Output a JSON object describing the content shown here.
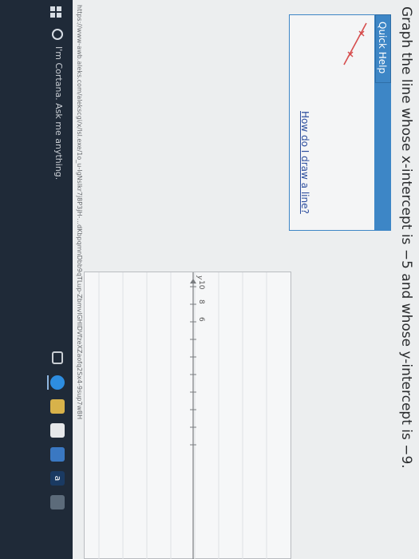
{
  "question": {
    "text": "Graph the line whose x-intercept is −5 and whose y-intercept is −9."
  },
  "quick_help": {
    "tab_label": "Quick Help",
    "link_text": "How do I draw a line?",
    "icon": "line-with-points-icon"
  },
  "browser": {
    "status_url": "https://www-awb.aleks.com/alekscgi/x/Isl.exe/1o_u-IgNslkr7j8P3jH-...dKbpqmnDbb9qTLup-ZbmvlGHIDVfzeXZaofq2Sx4-9sup7w8H"
  },
  "graph": {
    "y_axis_symbol": "y",
    "y_tick_labels": [
      "10",
      "8",
      "6"
    ],
    "ylim": [
      -10,
      10
    ]
  },
  "taskbar": {
    "search_placeholder": "I'm Cortana. Ask me anything.",
    "icons": [
      "windows-start-icon",
      "cortana-icon",
      "task-view-icon",
      "edge-icon",
      "file-explorer-icon",
      "store-icon",
      "mail-icon",
      "amazon-icon",
      "photos-icon"
    ],
    "amazon_glyph": "a"
  },
  "colors": {
    "accent": "#3d86c6",
    "link": "#2d4e9e",
    "taskbar": "#1f2a38"
  }
}
